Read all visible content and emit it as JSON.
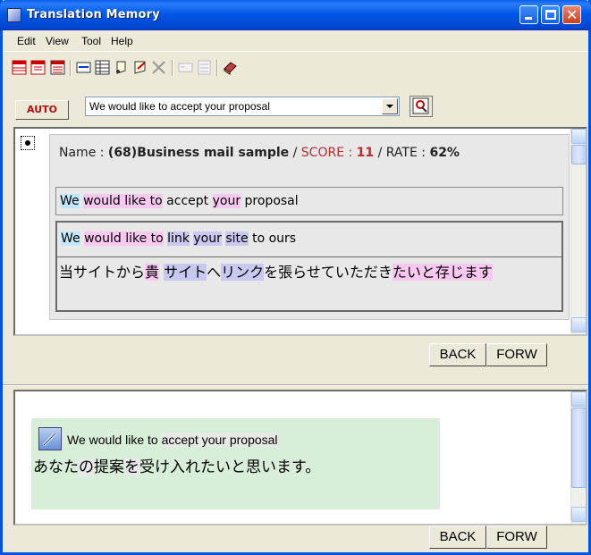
{
  "window": {
    "title": "Translation Memory"
  },
  "menu": {
    "items": [
      "Edit",
      "View",
      "Tool",
      "Help"
    ]
  },
  "toolbar": {
    "icons": [
      "table-red-icon",
      "table-red-2-icon",
      "table-red-3-icon",
      "list-icon",
      "grid-icon",
      "note-icon",
      "edit-note-icon",
      "delete-icon",
      "disabled-field-icon",
      "disabled-grid-icon",
      "book-icon"
    ]
  },
  "search": {
    "auto_label": "AUTO",
    "query": "We would like to accept your proposal"
  },
  "result": {
    "name_label": "Name : ",
    "name_value": "(68)Business mail sample",
    "sep1": " / ",
    "score_label": "SCORE : ",
    "score_value": "11",
    "sep2": " / RATE : ",
    "rate_value": "62%",
    "source_tokens": [
      {
        "text": "We",
        "hl": "blue"
      },
      {
        "text": " ",
        "hl": ""
      },
      {
        "text": "would like to",
        "hl": "pink"
      },
      {
        "text": " accept ",
        "hl": ""
      },
      {
        "text": "your",
        "hl": "pink"
      },
      {
        "text": " proposal",
        "hl": ""
      }
    ],
    "match_tokens": [
      {
        "text": "We",
        "hl": "blue"
      },
      {
        "text": " ",
        "hl": ""
      },
      {
        "text": "would like to",
        "hl": "pink"
      },
      {
        "text": " ",
        "hl": ""
      },
      {
        "text": "link",
        "hl": "purple"
      },
      {
        "text": " ",
        "hl": ""
      },
      {
        "text": "your",
        "hl": "purple"
      },
      {
        "text": " ",
        "hl": ""
      },
      {
        "text": "site",
        "hl": "purple"
      },
      {
        "text": " to ours",
        "hl": ""
      }
    ],
    "match_target_tokens": [
      {
        "text": "当サイトから",
        "hl": ""
      },
      {
        "text": "貴",
        "hl": "pink"
      },
      {
        "text": " ",
        "hl": ""
      },
      {
        "text": "サイト",
        "hl": "purple"
      },
      {
        "text": "へ",
        "hl": ""
      },
      {
        "text": "リンク",
        "hl": "purple"
      },
      {
        "text": "を張らせていただき",
        "hl": ""
      },
      {
        "text": "たいと存じます",
        "hl": "pink"
      }
    ]
  },
  "nav1": {
    "back": "BACK",
    "forw": "FORW"
  },
  "translation": {
    "source_tokens": [
      {
        "text": "We would like to ",
        "hl": ""
      },
      {
        "text": "accept your proposal",
        "hl": "gray"
      }
    ],
    "target_tokens": [
      {
        "text": "あなた",
        "hl": ""
      },
      {
        "text": "の",
        "hl": "gray"
      },
      {
        "text": "提案",
        "hl": ""
      },
      {
        "text": "を",
        "hl": "gray"
      },
      {
        "text": "受け入れ",
        "hl": ""
      },
      {
        "text": "たいと思います。",
        "hl": ""
      }
    ]
  },
  "nav2": {
    "back": "BACK",
    "forw": "FORW"
  }
}
